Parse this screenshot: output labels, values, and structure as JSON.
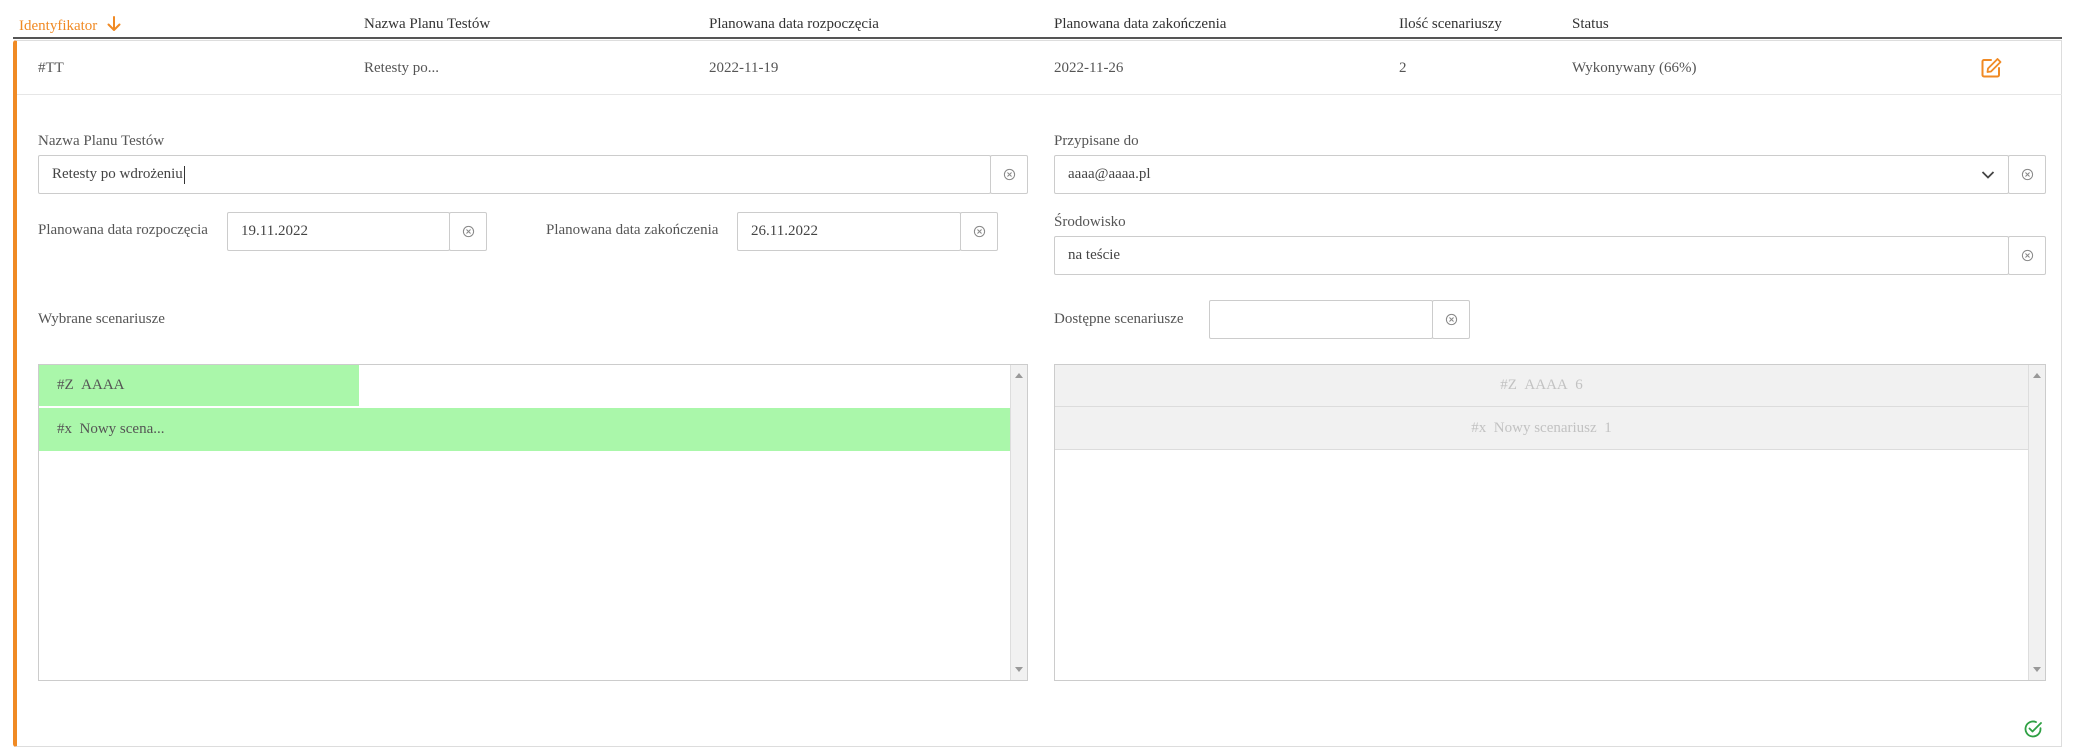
{
  "columns": {
    "id": "Identyfikator",
    "name": "Nazwa Planu Testów",
    "start": "Planowana data rozpoczęcia",
    "end": "Planowana data zakończenia",
    "count": "Ilość scenariuszy",
    "status": "Status"
  },
  "row": {
    "id": "#TT",
    "name": "Retesty po...",
    "start": "2022-11-19",
    "end": "2022-11-26",
    "count": "2",
    "status": "Wykonywany (66%)"
  },
  "form": {
    "name_label": "Nazwa Planu Testów",
    "name_value": "Retesty po wdrożeniu",
    "start_label": "Planowana data rozpoczęcia",
    "start_value": "19.11.2022",
    "end_label": "Planowana data zakończenia",
    "end_value": "26.11.2022",
    "assigned_label": "Przypisane do",
    "assigned_value": "aaaa@aaaa.pl",
    "env_label": "Środowisko",
    "env_value": "na teście",
    "selected_label": "Wybrane scenariusze",
    "available_label": "Dostępne scenariusze",
    "available_search": ""
  },
  "selected": [
    {
      "code": "#Z",
      "name": "AAAA"
    },
    {
      "code": "#x",
      "name": "Nowy scena..."
    }
  ],
  "available": [
    {
      "code": "#Z",
      "name": "AAAA",
      "count": "6"
    },
    {
      "code": "#x",
      "name": "Nowy scenariusz",
      "count": "1"
    }
  ],
  "colors": {
    "accent": "#f08a24",
    "selected_bg": "#aaf7aa",
    "confirm": "#2ea043"
  },
  "icons": {
    "sort": "arrow-down-icon",
    "edit": "edit-icon",
    "clear": "clear-circle-icon",
    "dropdown": "chevron-down-icon",
    "confirm": "check-circle-icon"
  }
}
